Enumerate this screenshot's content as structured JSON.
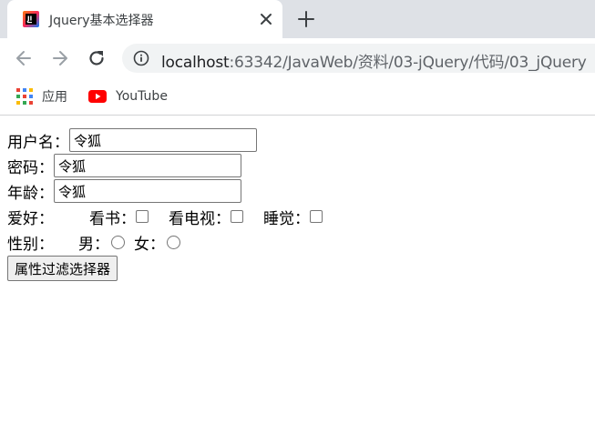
{
  "browser": {
    "tab": {
      "title": "Jquery基本选择器",
      "favicon": "jetbrains-icon"
    },
    "address": {
      "host": "localhost",
      "path": ":63342/JavaWeb/资料/03-jQuery/代码/03_jQuery"
    },
    "bookmarks": [
      {
        "label": "应用",
        "icon": "apps-grid-icon"
      },
      {
        "label": "YouTube",
        "icon": "youtube-icon"
      }
    ]
  },
  "form": {
    "username": {
      "label": "用户名：",
      "value": "令狐"
    },
    "password": {
      "label": "密码：",
      "value": "令狐"
    },
    "age": {
      "label": "年龄：",
      "value": "令狐"
    },
    "hobby": {
      "label": "爱好：",
      "options": [
        "看书：",
        "看电视：",
        "睡觉："
      ]
    },
    "gender": {
      "label": "性别：",
      "options": [
        "男：",
        "女："
      ]
    },
    "button_label": "属性过滤选择器"
  }
}
